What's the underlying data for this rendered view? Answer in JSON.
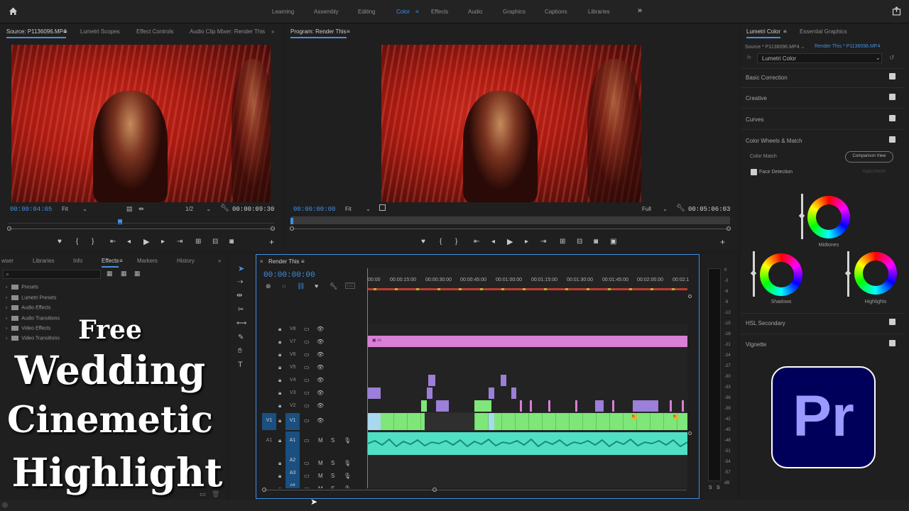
{
  "topbar": {
    "workspaces": [
      "Learning",
      "Assembly",
      "Editing",
      "Color",
      "Effects",
      "Audio",
      "Graphics",
      "Captions",
      "Libraries"
    ],
    "active": "Color"
  },
  "source_panel": {
    "tabs": [
      "Source: P1136096.MP4",
      "Lumetri Scopes",
      "Effect Controls",
      "Audio Clip Mixer: Render This"
    ],
    "timecode_in": "00:00:04:05",
    "fit": "Fit",
    "resolution": "1/2",
    "duration": "00:00:09:30"
  },
  "program_panel": {
    "tab": "Program: Render This",
    "timecode": "00:00:00:00",
    "fit": "Fit",
    "resolution": "Full",
    "duration": "00:05:06:03"
  },
  "lumetri": {
    "tabs": [
      "Lumetri Color",
      "Essential Graphics"
    ],
    "source_label": "Source * P1136096.MP4",
    "render_label": "Render This * P1136096.MP4",
    "fx_label": "fx",
    "effect_name": "Lumetri Color",
    "sections": [
      "Basic Correction",
      "Creative",
      "Curves",
      "Color Wheels & Match"
    ],
    "color_match": "Color Match",
    "comparison_view": "Comparison View",
    "face_detection": "Face Detection",
    "apply_match": "Apply Match",
    "wheels": [
      "Midtones",
      "Shadows",
      "Highlights"
    ],
    "bottom_sections": [
      "HSL Secondary",
      "Vignette"
    ]
  },
  "effects_panel": {
    "tabs": [
      "wser",
      "Libraries",
      "Info",
      "Effects",
      "Markers",
      "History"
    ],
    "items": [
      "Presets",
      "Lumetri Presets",
      "Audio Effects",
      "Audio Transitions",
      "Video Effects",
      "Video Transitions"
    ]
  },
  "overlay": {
    "line1": "Free",
    "line2": "Wedding",
    "line3": "Cinemetic",
    "line4": "Highlight"
  },
  "logo": {
    "text": "Pr",
    "color": "#9999ff",
    "bg": "#00005b"
  },
  "timeline": {
    "tab": "Render This",
    "timecode": "00:00:00:00",
    "ruler": [
      "00:00",
      "00:00:15:00",
      "00:00:30:00",
      "00:00:45:00",
      "00:01:00:00",
      "00:01:15:00",
      "00:01:30:00",
      "00:01:45:00",
      "00:02:00:00",
      "00:02:1"
    ],
    "video_tracks": [
      "V8",
      "V7",
      "V6",
      "V5",
      "V4",
      "V3",
      "V2",
      "V1"
    ],
    "audio_tracks": [
      "A1",
      "A2",
      "A3",
      "A4"
    ],
    "source_v1": "V1",
    "source_a1": "A1",
    "cc_label": "cc",
    "fx_badge": "fx",
    "track_buttons": {
      "mute": "M",
      "solo": "S"
    }
  },
  "meter": {
    "labels": [
      "0",
      "-3",
      "-6",
      "-9",
      "-12",
      "-15",
      "-18",
      "-21",
      "-24",
      "-27",
      "-30",
      "-33",
      "-36",
      "-39",
      "-42",
      "-45",
      "-48",
      "-51",
      "-54",
      "-57",
      "dB"
    ],
    "solo": "S"
  },
  "colors": {
    "accent": "#3f8fe6",
    "pink_clip": "#d97fd6",
    "green_clip": "#7fe77a",
    "audio_clip": "#4fe0c4",
    "purple_clip": "#9b7fd8"
  }
}
